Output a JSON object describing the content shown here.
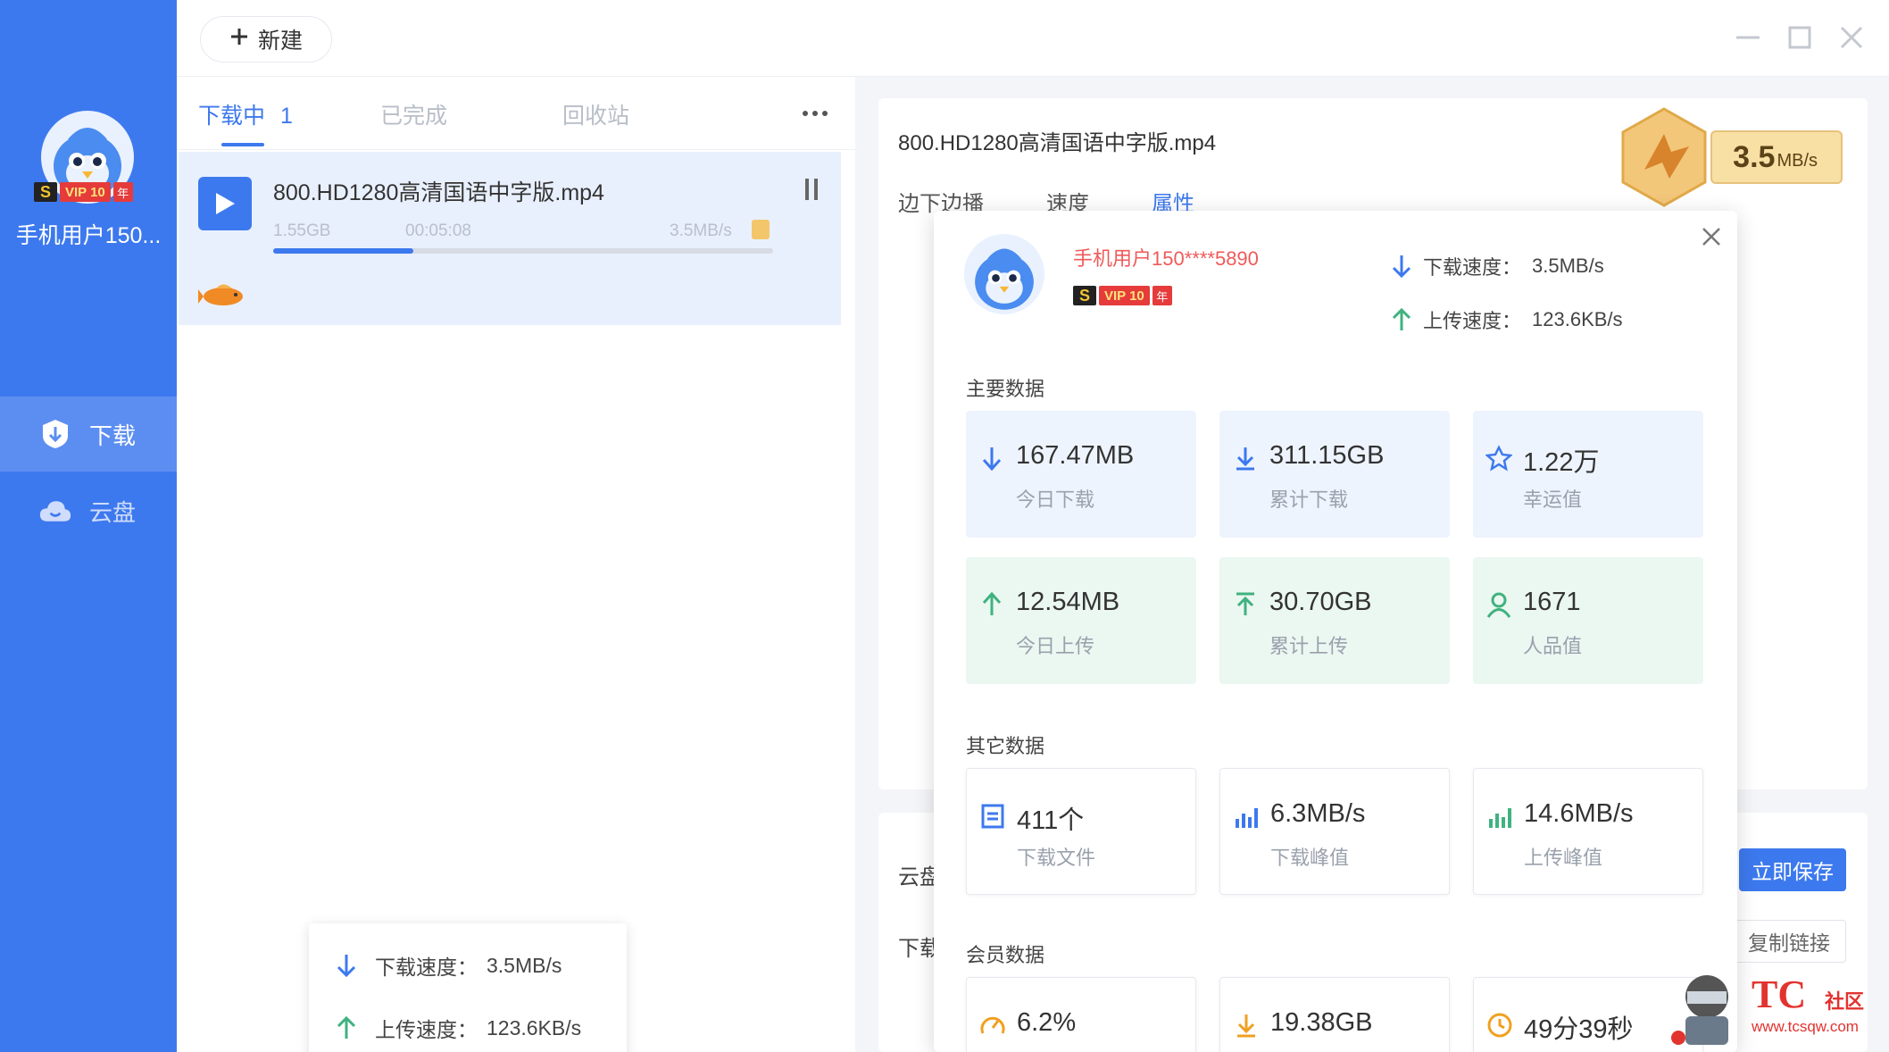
{
  "sidebar": {
    "username": "手机用户150...",
    "badges": {
      "s": "S",
      "vip": "VIP 10",
      "year": "年"
    },
    "nav": [
      {
        "label": "下载",
        "active": true
      },
      {
        "label": "云盘",
        "active": false
      }
    ]
  },
  "topbar": {
    "new_label": "新建"
  },
  "tabs": [
    {
      "label": "下载中",
      "count": "1",
      "active": true
    },
    {
      "label": "已完成"
    },
    {
      "label": "回收站"
    }
  ],
  "download_item": {
    "name": "800.HD1280高清国语中字版.mp4",
    "size": "1.55GB",
    "time": "00:05:08",
    "speed": "3.5MB/s",
    "progress": 0.28
  },
  "speed_popup": {
    "download": {
      "label": "下载速度：",
      "value": "3.5MB/s"
    },
    "upload": {
      "label": "上传速度：",
      "value": "123.6KB/s"
    }
  },
  "detail": {
    "title": "800.HD1280高清国语中字版.mp4",
    "tabs": [
      "边下边播",
      "速度",
      "属性"
    ],
    "active_tab": "属性",
    "speed_badge": {
      "value": "3.5",
      "unit": "MB/s"
    },
    "cloud_label": "云盘",
    "download_label": "下载",
    "save_button": "立即保存",
    "copy_button": "复制链接"
  },
  "popup": {
    "username": "手机用户150****5890",
    "badges": {
      "s": "S",
      "vip": "VIP 10",
      "year": "年"
    },
    "download_speed": {
      "label": "下载速度：",
      "value": "3.5MB/s"
    },
    "upload_speed": {
      "label": "上传速度：",
      "value": "123.6KB/s"
    },
    "main_title": "主要数据",
    "main": [
      {
        "value": "167.47MB",
        "label": "今日下载",
        "icon": "arrow-down-icon"
      },
      {
        "value": "311.15GB",
        "label": "累计下载",
        "icon": "download-icon"
      },
      {
        "value": "1.22万",
        "label": "幸运值",
        "icon": "star-icon"
      },
      {
        "value": "12.54MB",
        "label": "今日上传",
        "icon": "arrow-up-icon"
      },
      {
        "value": "30.70GB",
        "label": "累计上传",
        "icon": "upload-icon"
      },
      {
        "value": "1671",
        "label": "人品值",
        "icon": "user-icon"
      }
    ],
    "other_title": "其它数据",
    "other": [
      {
        "value": "411个",
        "label": "下载文件",
        "icon": "file-icon"
      },
      {
        "value": "6.3MB/s",
        "label": "下载峰值",
        "icon": "bar-chart-icon"
      },
      {
        "value": "14.6MB/s",
        "label": "上传峰值",
        "icon": "bar-chart-icon"
      }
    ],
    "member_title": "会员数据",
    "member": [
      {
        "value": "6.2%",
        "icon": "gauge-icon"
      },
      {
        "value": "19.38GB",
        "icon": "download-icon"
      },
      {
        "value": "49分39秒",
        "icon": "clock-icon"
      }
    ]
  },
  "watermark": {
    "brand": "TC",
    "suffix": "社区",
    "url": "www.tcsqw.com"
  },
  "colors": {
    "accent": "#3d79ee",
    "green": "#3fb27f",
    "red": "#ef5a5a"
  }
}
